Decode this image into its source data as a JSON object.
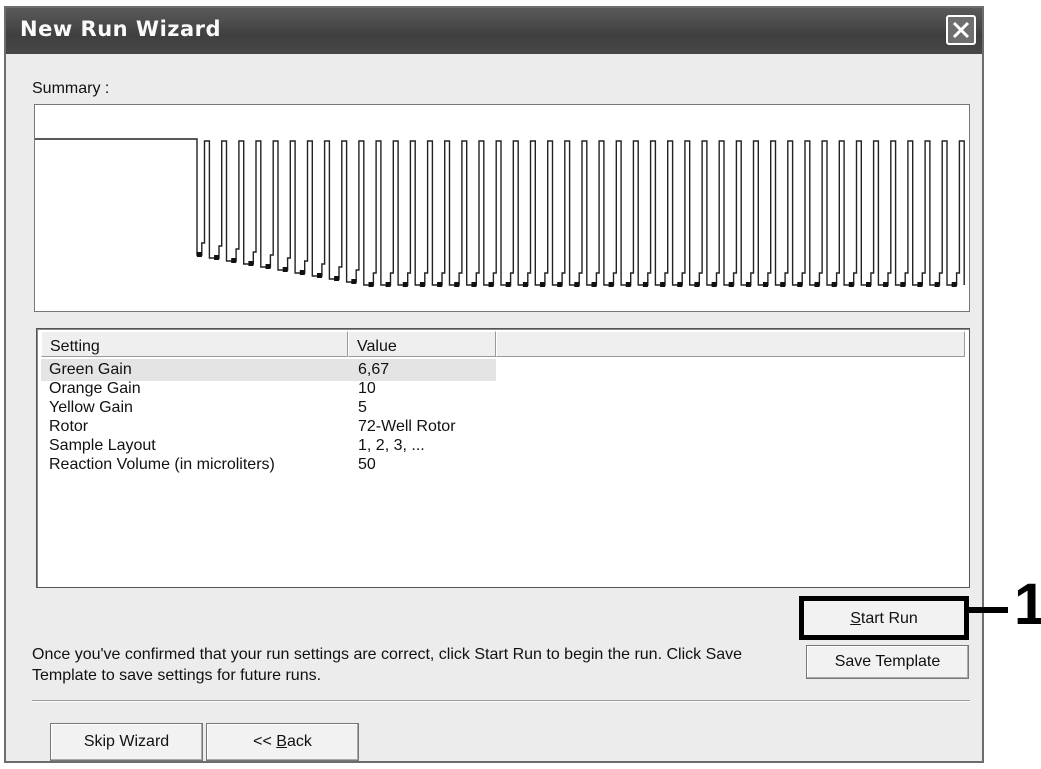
{
  "window": {
    "title": "New Run Wizard",
    "close_icon": "close-icon"
  },
  "summary": {
    "label": "Summary :",
    "profile": {
      "hold_segments": 1,
      "cycles": 45,
      "touchdown_cycles": 10
    }
  },
  "table": {
    "columns": [
      "Setting",
      "Value"
    ],
    "rows": [
      {
        "setting": "Green Gain",
        "value": "6,67"
      },
      {
        "setting": "Orange Gain",
        "value": "10"
      },
      {
        "setting": "Yellow Gain",
        "value": "5"
      },
      {
        "setting": "Rotor",
        "value": "72-Well Rotor"
      },
      {
        "setting": "Sample Layout",
        "value": "1, 2, 3, ..."
      },
      {
        "setting": "Reaction Volume (in microliters)",
        "value": "50"
      }
    ]
  },
  "instructions": "Once you've confirmed that your run settings are correct, click Start Run to begin the run. Click Save Template to save settings for future runs.",
  "buttons": {
    "start_run_mnemonic": "S",
    "start_run_rest": "tart Run",
    "save_template": "Save Template",
    "skip_wizard": "Skip Wizard",
    "back_prefix": "<< ",
    "back_mnemonic": "B",
    "back_rest": "ack"
  },
  "callout": {
    "number": "1"
  }
}
